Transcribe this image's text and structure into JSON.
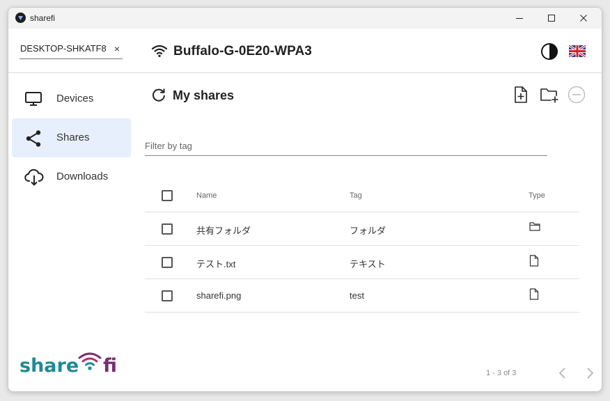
{
  "window": {
    "title": "sharefi",
    "controls": [
      "minimize-icon",
      "maximize-icon",
      "close-icon"
    ]
  },
  "header": {
    "host": "DESKTOP-SHKATF8",
    "host_clear": "×",
    "network_name": "Buffalo-G-0E20-WPA3",
    "icons": [
      "wifi-icon",
      "theme-toggle-icon",
      "uk-flag-icon"
    ]
  },
  "sidebar": {
    "items": [
      {
        "label": "Devices",
        "icon": "monitor-icon",
        "active": false
      },
      {
        "label": "Shares",
        "icon": "share-icon",
        "active": true
      },
      {
        "label": "Downloads",
        "icon": "cloud-download-icon",
        "active": false
      }
    ],
    "logo": {
      "text_left": "share",
      "text_right": "fi",
      "colors": {
        "teal": "#1e8a96",
        "purple": "#7b2d6e",
        "magenta": "#b0306e"
      }
    }
  },
  "main": {
    "title": "My shares",
    "actions": [
      "add-file-icon",
      "add-folder-icon",
      "remove-icon"
    ],
    "filter": {
      "placeholder": "Filter by tag",
      "value": ""
    },
    "table": {
      "columns": [
        "Name",
        "Tag",
        "Type"
      ],
      "rows": [
        {
          "name": "共有フォルダ",
          "tag": "フォルダ",
          "type": "folder-icon"
        },
        {
          "name": "テスト.txt",
          "tag": "テキスト",
          "type": "file-icon"
        },
        {
          "name": "sharefi.png",
          "tag": "test",
          "type": "file-icon"
        }
      ]
    },
    "pagination": {
      "range": "1 - 3 of 3"
    }
  },
  "colors": {
    "active_nav_bg": "#e7effc",
    "titlebar_bg": "#f3f3f3"
  }
}
